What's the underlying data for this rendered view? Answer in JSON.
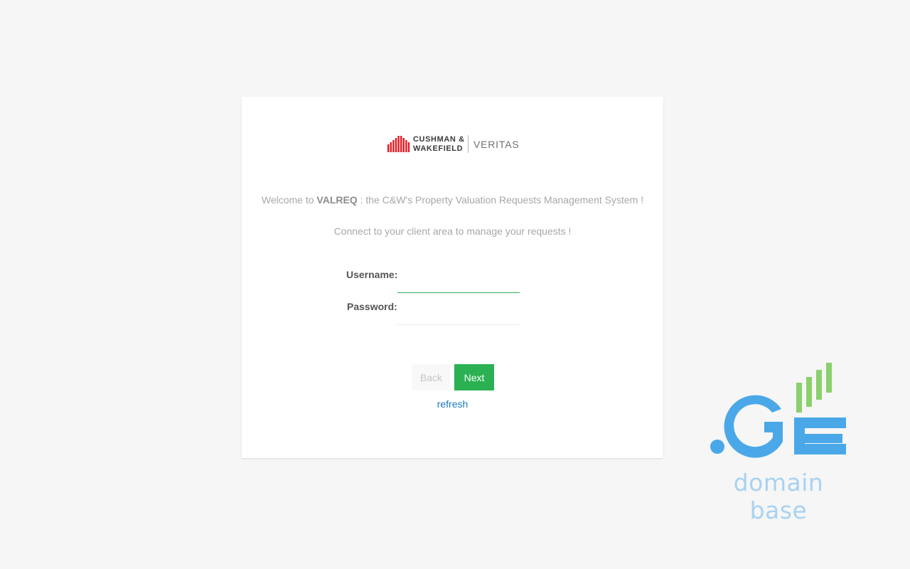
{
  "logo": {
    "brand_line1": "CUSHMAN &",
    "brand_line2": "WAKEFIELD",
    "product": "VERITAS",
    "brand_color": "#e31b23"
  },
  "intro": {
    "welcome_prefix": "Welcome to ",
    "app_name": "VALREQ",
    "welcome_suffix": " : the C&W's Property Valuation Requests Management System !",
    "connect_text": "Connect to your client area to manage your requests !"
  },
  "form": {
    "username_label": "Username:",
    "username_value": "",
    "password_label": "Password:",
    "password_value": ""
  },
  "actions": {
    "back_label": "Back",
    "next_label": "Next",
    "refresh_label": "refresh",
    "accent_color": "#2bb153"
  },
  "watermark": {
    "mark": ".GE",
    "caption": "domain base",
    "blue": "#4aa8e8",
    "green": "#8ad06c"
  }
}
